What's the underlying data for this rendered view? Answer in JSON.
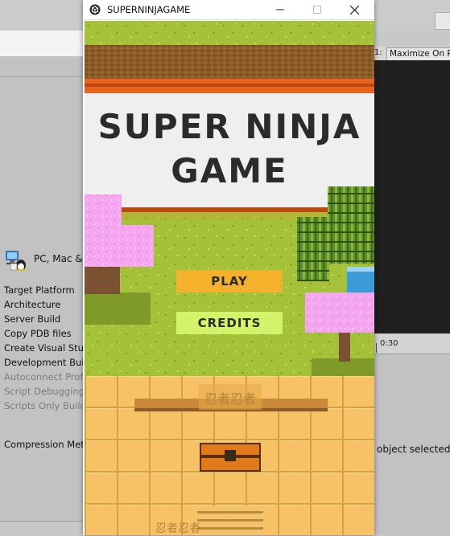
{
  "window": {
    "title": "SUPERNINJAGAME"
  },
  "game": {
    "title_line1": "SUPER NINJA",
    "title_line2": "GAME",
    "play_label": "PLAY",
    "credits_label": "CREDITS",
    "kanji": "忍者忍者"
  },
  "editor": {
    "platform_label": "PC, Mac &",
    "settings": [
      "Target Platform",
      "Architecture",
      "Server Build",
      "Copy PDB files",
      "Create Visual Stu",
      "Development Bui",
      "Autoconnect Prof",
      "Script Debugging",
      "Scripts Only Build"
    ],
    "compression_label": "Compression Met",
    "maximize_label": "Maximize On P",
    "ratio_fragment": "1:",
    "timeline_label": "0:30",
    "status_fragment": "object selected."
  },
  "colors": {
    "grass": "#a5c13a",
    "grass_dark": "#7f9a27",
    "brown": "#8c5b2a",
    "orange_stripe": "#e8641e",
    "banner_bg": "#efefef",
    "title_text": "#2b2b2b",
    "play_button": "#f4b22c",
    "credits_button": "#d3f36a",
    "sakura": "#f4a6ef",
    "tile_floor": "#f7c266",
    "tile_border": "#b98a3a"
  }
}
